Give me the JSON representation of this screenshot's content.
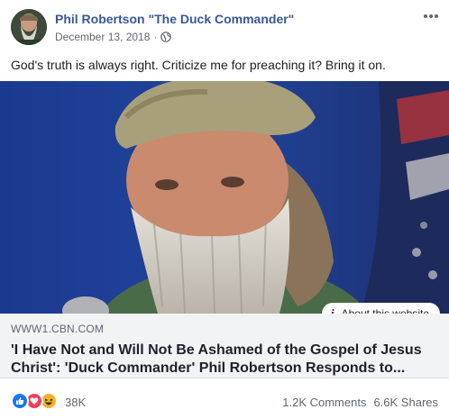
{
  "post": {
    "author": "Phil Robertson \"The Duck Commander\"",
    "date": "December 13, 2018",
    "separator": "·",
    "privacy_icon": "globe-icon",
    "more_icon": "more-options-icon",
    "text": "God's truth is always right. Criticize me for preaching it? Bring it on."
  },
  "link": {
    "domain": "WWW1.CBN.COM",
    "title": "'I Have Not and Will Not Be Ashamed of the Gospel of Jesus Christ': 'Duck Commander' Phil Robertson Responds to...",
    "about_label": "About this website",
    "about_icon": "info-icon",
    "image_desc_icon": "bearded-man-photo"
  },
  "reactions": {
    "icons": [
      "like-icon",
      "love-icon",
      "haha-icon"
    ],
    "count": "38K",
    "comments": "1.2K Comments",
    "shares": "6.6K Shares"
  },
  "colors": {
    "author_link": "#385898",
    "like": "#1877f2",
    "love": "#f33e58",
    "haha": "#f7b125",
    "caption_bg": "#f2f3f5"
  }
}
